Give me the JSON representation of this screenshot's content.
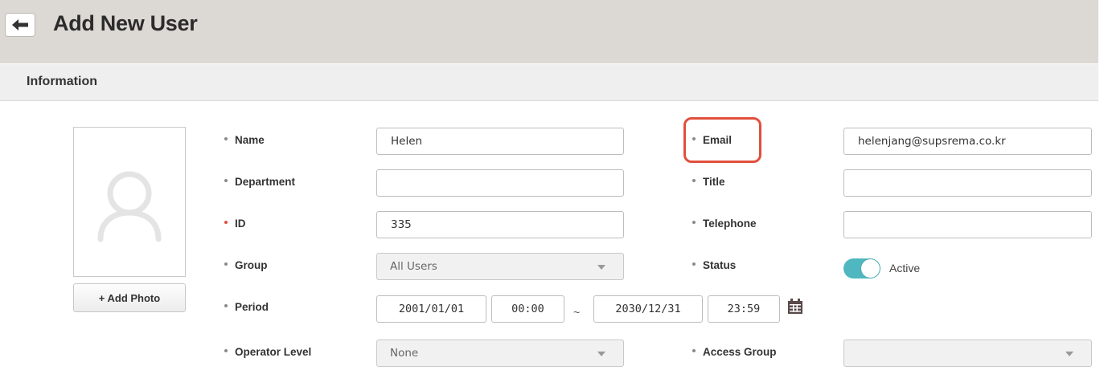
{
  "header": {
    "title": "Add New User",
    "back_icon": "arrow-left-icon"
  },
  "section": {
    "title": "Information"
  },
  "photo": {
    "placeholder_icon": "user-silhouette-icon",
    "add_photo_label": "+ Add Photo"
  },
  "form": {
    "name": {
      "label": "Name",
      "value": "Helen"
    },
    "department": {
      "label": "Department",
      "value": ""
    },
    "id": {
      "label": "ID",
      "value": "335",
      "required": true
    },
    "group": {
      "label": "Group",
      "value": "All Users"
    },
    "period": {
      "label": "Period",
      "start_date": "2001/01/01",
      "start_time": "00:00",
      "separator": "~",
      "end_date": "2030/12/31",
      "end_time": "23:59",
      "calendar_icon": "calendar-icon"
    },
    "operator_level": {
      "label": "Operator Level",
      "value": "None"
    },
    "email": {
      "label": "Email",
      "value": "helenjang@supsrema.co.kr"
    },
    "title": {
      "label": "Title",
      "value": ""
    },
    "telephone": {
      "label": "Telephone",
      "value": ""
    },
    "status": {
      "label": "Status",
      "value": "Active",
      "enabled": true
    },
    "access_group": {
      "label": "Access Group",
      "value": ""
    }
  },
  "colors": {
    "header_bg": "#dcd8d4",
    "toggle_on": "#4fb7bf",
    "highlight": "#e0503c",
    "required_dot": "#e0503c"
  }
}
